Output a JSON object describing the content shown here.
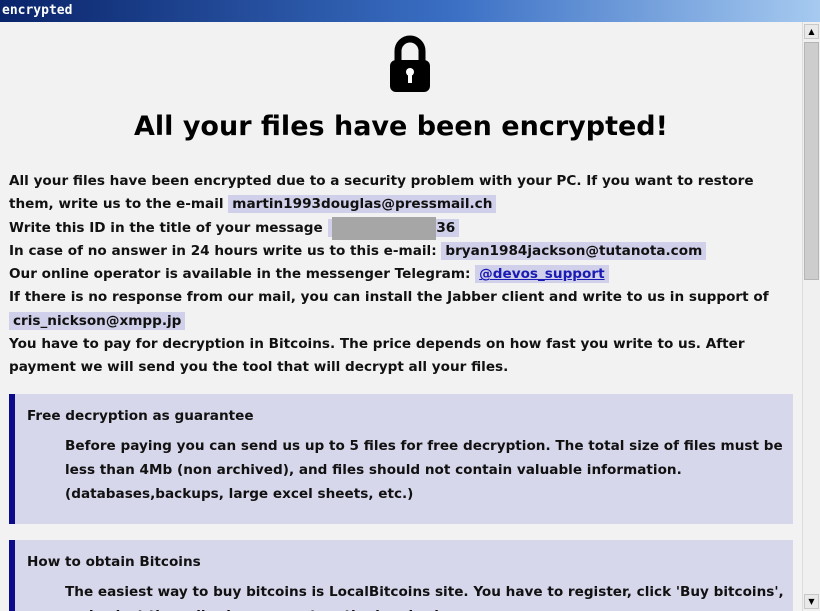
{
  "window": {
    "title": "encrypted"
  },
  "heading": "All your files have been encrypted!",
  "message": {
    "line1": "All your files have been encrypted due to a security problem with your PC. If you want to restore them, write us to the e-mail",
    "email1": "martin1993douglas@pressmail.ch",
    "id_prefix": "Write this ID in the title of your message",
    "id_visible": "36",
    "no_answer": "In case of no answer in 24 hours write us to this e-mail:",
    "email2": "bryan1984jackson@tutanota.com",
    "telegram_prefix": "Our online operator is available in the messenger Telegram:",
    "telegram_handle": "@devos_support",
    "jabber": "If there is no response from our mail, you can install the Jabber client and write to us in support of",
    "jabber_id": "cris_nickson@xmpp.jp",
    "payment": "You have to pay for decryption in Bitcoins. The price depends on how fast you write to us. After payment we will send you the tool that will decrypt all your files."
  },
  "free_decryption": {
    "title": "Free decryption as guarantee",
    "text": "Before paying you can send us up to 5 files for free decryption. The total size of files must be less than 4Mb (non archived), and files should not contain valuable information. (databases,backups, large excel sheets, etc.)"
  },
  "bitcoins": {
    "title": "How to obtain Bitcoins",
    "text": "The easiest way to buy bitcoins is LocalBitcoins site. You have to register, click 'Buy bitcoins', and select the seller by payment method and price."
  },
  "colors": {
    "highlight": "#d0d0ea",
    "box_background": "#d7d7ec",
    "box_border": "#0b0b8c",
    "link": "#1a1ab4"
  },
  "icons": {
    "lock": "padlock-icon",
    "scroll_up": "arrow-up-icon",
    "scroll_down": "arrow-down-icon"
  }
}
